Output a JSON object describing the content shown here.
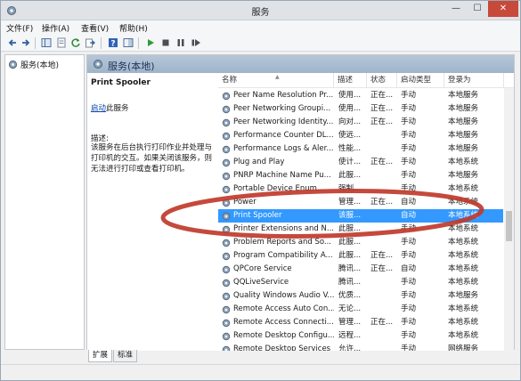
{
  "window": {
    "title": "服务",
    "close_glyph": "✕",
    "min_glyph": "—",
    "max_glyph": "☐"
  },
  "menu": [
    "文件(F)",
    "操作(A)",
    "查看(V)",
    "帮助(H)"
  ],
  "toolbar": [
    "back-icon",
    "forward-icon",
    "console-tree-icon",
    "properties-icon",
    "refresh-icon",
    "export-icon",
    "help-icon",
    "show-hide-icon",
    "start-icon",
    "stop-icon",
    "pause-icon",
    "restart-icon"
  ],
  "tree": {
    "root_label": "服务(本地)"
  },
  "right_header": {
    "title": "服务(本地)"
  },
  "details": {
    "service_name": "Print Spooler",
    "link_text": "启动",
    "link_suffix": "此服务",
    "desc_label": "描述:",
    "desc_text": "该服务在后台执行打印作业并处理与打印机的交互。如果关闭该服务，则无法进行打印或查看打印机。"
  },
  "columns": {
    "name": "名称",
    "desc": "描述",
    "status": "状态",
    "start": "启动类型",
    "logon": "登录为"
  },
  "rows": [
    {
      "name": "Peer Name Resolution Pr...",
      "desc": "使用...",
      "status": "正在...",
      "start": "手动",
      "logon": "本地服务"
    },
    {
      "name": "Peer Networking Groupi...",
      "desc": "使用...",
      "status": "正在...",
      "start": "手动",
      "logon": "本地服务"
    },
    {
      "name": "Peer Networking Identity...",
      "desc": "向对...",
      "status": "正在...",
      "start": "手动",
      "logon": "本地服务"
    },
    {
      "name": "Performance Counter DL...",
      "desc": "使远...",
      "status": "",
      "start": "手动",
      "logon": "本地服务"
    },
    {
      "name": "Performance Logs & Aler...",
      "desc": "性能...",
      "status": "",
      "start": "手动",
      "logon": "本地服务"
    },
    {
      "name": "Plug and Play",
      "desc": "使计...",
      "status": "正在...",
      "start": "手动",
      "logon": "本地系统"
    },
    {
      "name": "PNRP Machine Name Pu...",
      "desc": "此服...",
      "status": "",
      "start": "手动",
      "logon": "本地服务"
    },
    {
      "name": "Portable Device Enum...",
      "desc": "强制...",
      "status": "",
      "start": "手动",
      "logon": "本地系统"
    },
    {
      "name": "Power",
      "desc": "管理...",
      "status": "正在...",
      "start": "自动",
      "logon": "本地系统"
    },
    {
      "name": "Print Spooler",
      "desc": "该服...",
      "status": "",
      "start": "自动",
      "logon": "本地系统",
      "selected": true
    },
    {
      "name": "Printer Extensions and N...",
      "desc": "此服...",
      "status": "",
      "start": "手动",
      "logon": "本地系统"
    },
    {
      "name": "Problem Reports and So...",
      "desc": "此服...",
      "status": "",
      "start": "手动",
      "logon": "本地系统"
    },
    {
      "name": "Program Compatibility A...",
      "desc": "此服...",
      "status": "正在...",
      "start": "手动",
      "logon": "本地系统"
    },
    {
      "name": "QPCore Service",
      "desc": "腾讯...",
      "status": "正在...",
      "start": "自动",
      "logon": "本地系统"
    },
    {
      "name": "QQLiveService",
      "desc": "腾讯...",
      "status": "",
      "start": "手动",
      "logon": "本地系统"
    },
    {
      "name": "Quality Windows Audio V...",
      "desc": "优质...",
      "status": "",
      "start": "手动",
      "logon": "本地服务"
    },
    {
      "name": "Remote Access Auto Con...",
      "desc": "无论...",
      "status": "",
      "start": "手动",
      "logon": "本地系统"
    },
    {
      "name": "Remote Access Connecti...",
      "desc": "管理...",
      "status": "正在...",
      "start": "手动",
      "logon": "本地系统"
    },
    {
      "name": "Remote Desktop Configu...",
      "desc": "远程...",
      "status": "",
      "start": "手动",
      "logon": "本地系统"
    },
    {
      "name": "Remote Desktop Services",
      "desc": "允许...",
      "status": "",
      "start": "手动",
      "logon": "网络服务"
    }
  ],
  "tabs": [
    "扩展",
    "标准"
  ],
  "colors": {
    "selection": "#3399ff",
    "annotation": "#c0392b",
    "header": "#a9bcd1"
  }
}
